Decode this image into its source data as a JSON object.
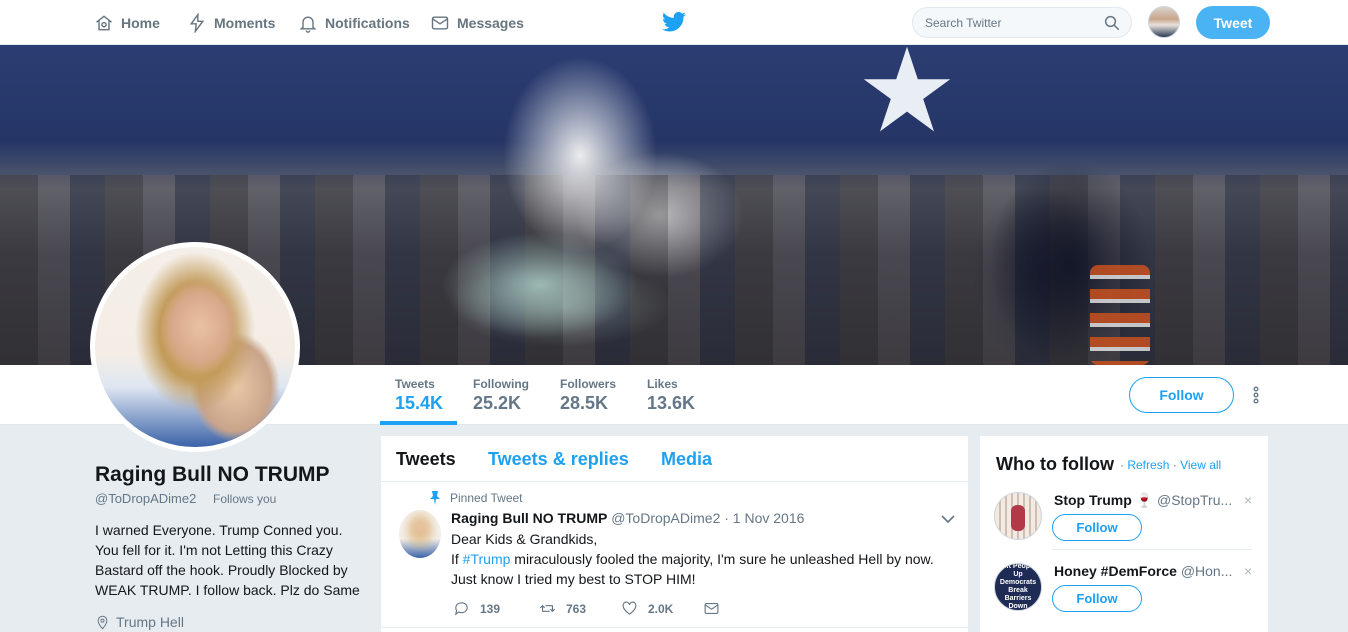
{
  "nav": {
    "home": "Home",
    "moments": "Moments",
    "notifications": "Notifications",
    "messages": "Messages",
    "search_placeholder": "Search Twitter",
    "tweet_button": "Tweet"
  },
  "profile": {
    "name": "Raging Bull NO TRUMP",
    "handle": "@ToDropADime2",
    "follows_you": "Follows you",
    "bio": "I warned Everyone. Trump Conned you. You fell for it. I'm not Letting this Crazy Bastard off the hook. Proudly Blocked by WEAK TRUMP. I follow back. Plz do Same",
    "location": "Trump Hell",
    "follow_button": "Follow"
  },
  "stats": [
    {
      "label": "Tweets",
      "value": "15.4K"
    },
    {
      "label": "Following",
      "value": "25.2K"
    },
    {
      "label": "Followers",
      "value": "28.5K"
    },
    {
      "label": "Likes",
      "value": "13.6K"
    }
  ],
  "timeline": {
    "tabs": [
      "Tweets",
      "Tweets & replies",
      "Media"
    ],
    "pinned_label": "Pinned Tweet",
    "tweet": {
      "name": "Raging Bull NO TRUMP",
      "handle_date": "@ToDropADime2 · 1 Nov 2016",
      "line1": "Dear Kids & Grandkids,",
      "line2_pre": "If ",
      "hashtag": "#Trump",
      "line2_post": " miraculously fooled the majority, I'm sure he unleashed Hell by now.",
      "line3": "Just know I tried my best to STOP HIM!",
      "replies": "139",
      "retweets": "763",
      "likes": "2.0K"
    }
  },
  "who_to_follow": {
    "title": "Who to follow",
    "refresh": "Refresh",
    "view_all": "View all",
    "separator": "·",
    "suggestions": [
      {
        "name": "Stop Trump 🍷",
        "handle": "@StopTru...",
        "follow": "Follow",
        "close": "×"
      },
      {
        "name": "Honey #DemForce",
        "handle": "@Hon...",
        "follow": "Follow",
        "close": "×",
        "avatar_text": "Lift People Up Democrats Break Barriers Down"
      }
    ]
  },
  "colors": {
    "accent": "#1da1f2",
    "tweet_button": "#4ab3f4",
    "background": "#e6ecf0",
    "muted": "#657786"
  }
}
